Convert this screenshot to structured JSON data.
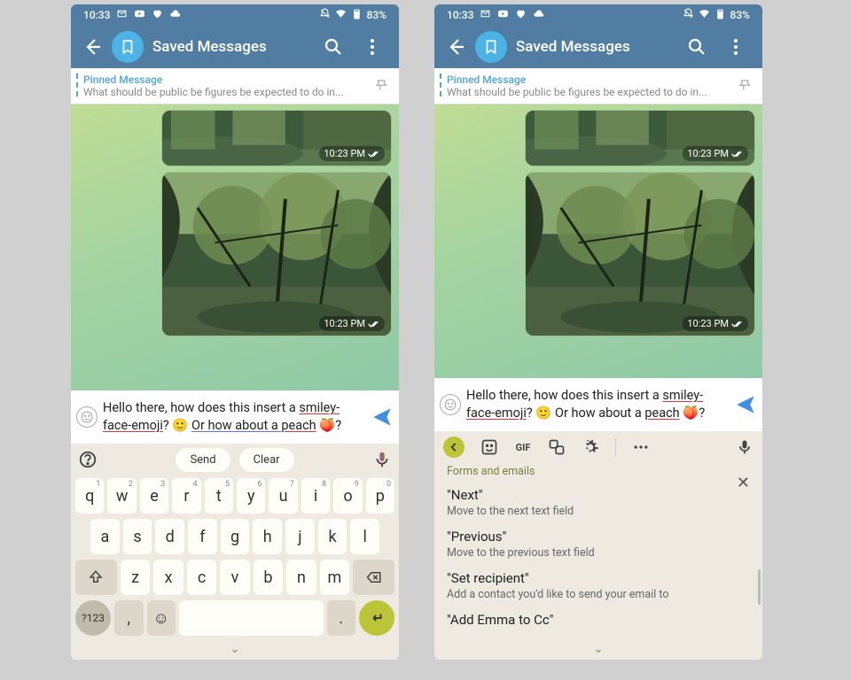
{
  "status": {
    "time": "10:33",
    "battery": "83%"
  },
  "header": {
    "title": "Saved Messages"
  },
  "pinned": {
    "title": "Pinned Message",
    "text": "What should be public be figures be expected to do in..."
  },
  "messages": {
    "photo_time": "10:23 PM"
  },
  "input": {
    "part1": "Hello there, how does this insert a ",
    "underlined1": "smiley-face-emoji",
    "part2": "? ",
    "emoji1": "🙂",
    "part3": " ",
    "underlined2": "Or how about a ",
    "underlined3": "peach",
    "part4": " ",
    "emoji2": "🍑",
    "part5": "?"
  },
  "keyboard": {
    "suggestions": [
      "Send",
      "Clear"
    ],
    "row1": [
      {
        "k": "q",
        "s": "1"
      },
      {
        "k": "w",
        "s": "2"
      },
      {
        "k": "e",
        "s": "3"
      },
      {
        "k": "r",
        "s": "4"
      },
      {
        "k": "t",
        "s": "5"
      },
      {
        "k": "y",
        "s": "6"
      },
      {
        "k": "u",
        "s": "7"
      },
      {
        "k": "i",
        "s": "8"
      },
      {
        "k": "o",
        "s": "9"
      },
      {
        "k": "p",
        "s": "0"
      }
    ],
    "row2": [
      "a",
      "s",
      "d",
      "f",
      "g",
      "h",
      "j",
      "k",
      "l"
    ],
    "row3": [
      "z",
      "x",
      "c",
      "v",
      "b",
      "n",
      "m"
    ],
    "sym": "?123",
    "comma": ",",
    "period": "."
  },
  "voice": {
    "gif_label": "GIF",
    "heading": "Forms and emails",
    "items": [
      {
        "cmd": "\"Next\"",
        "desc": "Move to the next text field"
      },
      {
        "cmd": "\"Previous\"",
        "desc": "Move to the previous text field"
      },
      {
        "cmd": "\"Set recipient\"",
        "desc": "Add a contact you'd like to send your email to"
      },
      {
        "cmd": "\"Add Emma to Cc\"",
        "desc": ""
      }
    ]
  }
}
